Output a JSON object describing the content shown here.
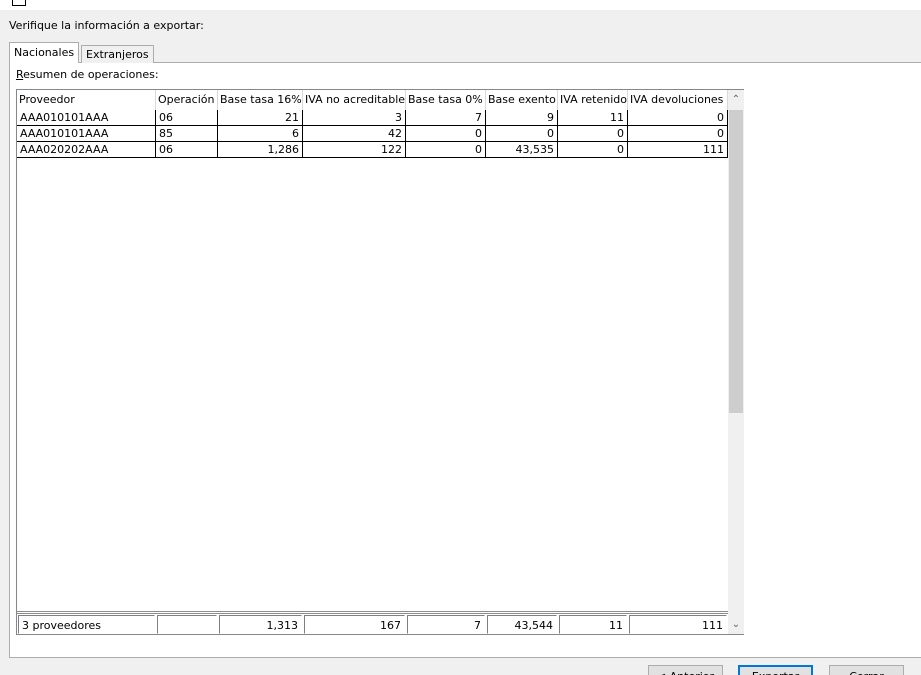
{
  "instruction": "Verifique la información a exportar:",
  "tabs": [
    {
      "label": "Nacionales",
      "active": true
    },
    {
      "label": "Extranjeros",
      "active": false
    }
  ],
  "section": {
    "label_first": "R",
    "label_rest": "esumen de operaciones:"
  },
  "table": {
    "columns": [
      "Proveedor",
      "Operación",
      "Base tasa 16%",
      "IVA no acreditable",
      "Base tasa 0%",
      "Base exento",
      "IVA retenido",
      "IVA devoluciones"
    ],
    "rows": [
      [
        "AAA010101AAA",
        "06",
        "21",
        "3",
        "7",
        "9",
        "11",
        "0"
      ],
      [
        "AAA010101AAA",
        "85",
        "6",
        "42",
        "0",
        "0",
        "0",
        "0"
      ],
      [
        "AAA020202AAA",
        "06",
        "1,286",
        "122",
        "0",
        "43,535",
        "0",
        "111"
      ]
    ],
    "totals": [
      "3 proveedores",
      "",
      "1,313",
      "167",
      "7",
      "43,544",
      "11",
      "111"
    ]
  },
  "scrollbar": {
    "up_icon": "chevron-up-icon",
    "down_icon": "chevron-down-icon"
  },
  "buttons": {
    "back": "< Anterior",
    "export": "Exportar",
    "cancel": "Cerrar"
  }
}
